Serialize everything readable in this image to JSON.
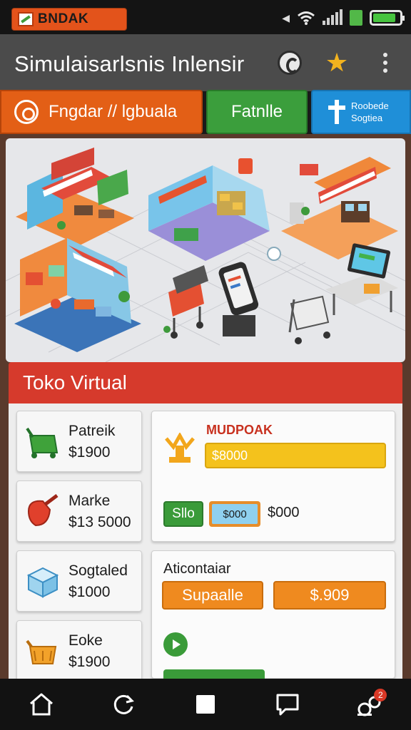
{
  "status_bar": {
    "chip_label": "BNDAK",
    "chip_color": "#e3531b",
    "battery_level": 0.85,
    "icons": [
      "app-logo-icon",
      "location-arrow-icon",
      "wifi-icon",
      "cell-signal-icon",
      "battery-icon"
    ]
  },
  "app_bar": {
    "title": "Simulaisarlsnis Inlensir",
    "actions": [
      "sync-icon",
      "star-icon",
      "more-vert-icon"
    ]
  },
  "tabs": [
    {
      "label": "Fngdar // lgbuala",
      "color": "#e35f16",
      "icon": "settings-badge-icon"
    },
    {
      "label": "Fatnlle",
      "color": "#3b9e3c"
    },
    {
      "label_line1": "Roobede",
      "label_line2": "Sogtiea",
      "color": "#1f8fd8",
      "icon": "cross-icon"
    }
  ],
  "scene": {
    "description_icons": [
      "market-stall-icon",
      "store-interior-icon",
      "awning-shop-icon",
      "cafe-icon",
      "shopping-cart-icon",
      "tablet-kiosk-icon",
      "trolley-icon",
      "computer-desk-icon"
    ]
  },
  "banner": {
    "title": "Toko Virtual",
    "color": "#d63a2c"
  },
  "items": [
    {
      "name": "Patreik",
      "price": "$1900",
      "icon": "green-cart-icon"
    },
    {
      "name": "Marke",
      "price": "$13 5000",
      "icon": "red-bag-icon"
    },
    {
      "name": "Sogtaled",
      "price": "$1000",
      "icon": "blue-box-icon"
    },
    {
      "name": "Eoke",
      "price": "$1900",
      "icon": "orange-basket-icon"
    }
  ],
  "panel1": {
    "title": "MUDPOAK",
    "bar_value": "$8000",
    "chip_label": "Sllo",
    "input_value": "$000",
    "amount": "$000",
    "icon": "trophy-icon"
  },
  "panel2": {
    "title": "Aticontaiar",
    "button1": "Supaalle",
    "button2": "$.909",
    "play_icon": "play-icon"
  },
  "nav_bar": {
    "buttons": [
      "home-icon",
      "refresh-icon",
      "square-icon",
      "chat-icon",
      "apps-icon"
    ],
    "badge": "2"
  }
}
